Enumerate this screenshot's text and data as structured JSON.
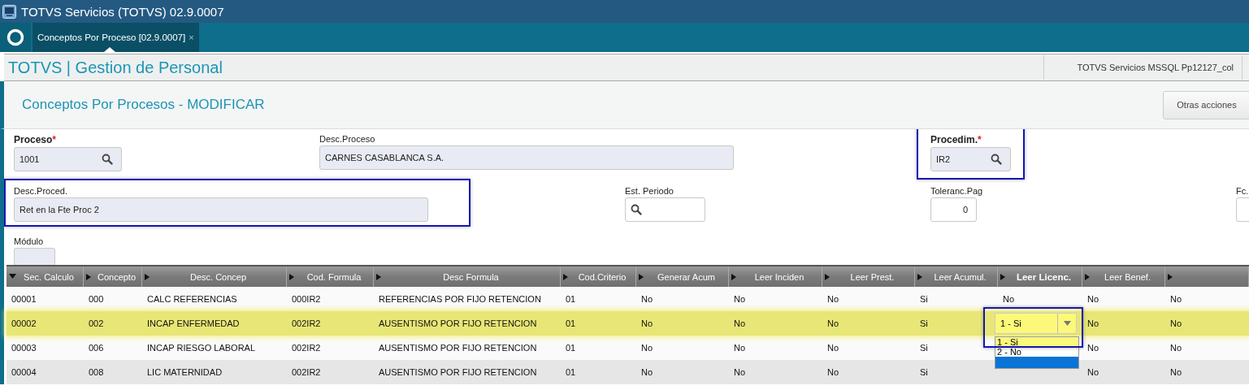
{
  "window": {
    "title": "TOTVS Servicios (TOTVS) 02.9.0007"
  },
  "tabs": [
    {
      "label": "Conceptos Por Proceso [02.9.0007]",
      "close": "×",
      "selected": true
    }
  ],
  "header": {
    "title": "TOTVS | Gestion de Personal",
    "environment": "TOTVS Servicios MSSQL Pp12127_col"
  },
  "page": {
    "title": "Conceptos Por Procesos - MODIFICAR",
    "actions": [
      "Otras acciones"
    ]
  },
  "form": {
    "fields": [
      {
        "kind": "lookup",
        "label": "Proceso",
        "required_mark": "*",
        "value": "1001",
        "editable": false
      },
      {
        "kind": "text",
        "label": "Desc.Proceso",
        "value": "CARNES CASABLANCA S.A.",
        "editable": false
      },
      {
        "kind": "lookup",
        "label": "Procedim.",
        "required_mark": "*",
        "value": "IR2",
        "editable": false,
        "highlighted": true
      },
      {
        "kind": "text",
        "label": "Desc.Proced.",
        "value": "Ret en la Fte Proc 2",
        "editable": false,
        "highlighted": true
      },
      {
        "kind": "lookup",
        "label": "Est. Periodo",
        "editable": true
      },
      {
        "kind": "number",
        "label": "Toleranc.Pag",
        "value": "0",
        "editable": true
      },
      {
        "kind": "text",
        "label": "Fc.",
        "editable": true
      },
      {
        "kind": "text",
        "label": "Módulo",
        "editable": false
      }
    ]
  },
  "table": {
    "columns": [
      {
        "label": "Sec. Calculo",
        "sorted": true,
        "active": false
      },
      {
        "label": "Concepto",
        "sorted": false,
        "active": false
      },
      {
        "label": "Desc. Concep",
        "sorted": false,
        "active": false
      },
      {
        "label": "Cod. Formula",
        "sorted": false,
        "active": false
      },
      {
        "label": "Desc Formula",
        "sorted": false,
        "active": false
      },
      {
        "label": "Cod.Criterio",
        "sorted": false,
        "active": false
      },
      {
        "label": "Generar Acum",
        "sorted": false,
        "active": false
      },
      {
        "label": "Leer Inciden",
        "sorted": false,
        "active": false
      },
      {
        "label": "Leer Prest.",
        "sorted": false,
        "active": false
      },
      {
        "label": "Leer Acumul.",
        "sorted": false,
        "active": false
      },
      {
        "label": "Leer Licenc.",
        "sorted": false,
        "active": true
      },
      {
        "label": "Leer Benef.",
        "sorted": false,
        "active": false
      },
      {
        "sorted": false
      }
    ],
    "rows": [
      {
        "selected": false,
        "cells": [
          "00001",
          "000",
          "CALC REFERENCIAS",
          "000IR2",
          "REFERENCIAS POR FIJO RETENCION",
          "01",
          "No",
          "No",
          "No",
          "Si",
          "No",
          "No",
          "No"
        ]
      },
      {
        "selected": true,
        "cells": [
          "00002",
          "002",
          "INCAP ENFERMEDAD",
          "002IR2",
          "AUSENTISMO POR FIJO RETENCION",
          "01",
          "No",
          "No",
          "No",
          "Si",
          {
            "kind": "dropdown",
            "value": "1 - Si",
            "highlighted": true,
            "options": [
              {
                "label": "1 - Si",
                "selected": true,
                "hovered": false
              },
              {
                "label": "2 - No",
                "selected": false,
                "hovered": false
              },
              {
                "selected": false,
                "hovered": true
              }
            ]
          },
          "No",
          "No"
        ]
      },
      {
        "selected": false,
        "cells": [
          "00003",
          "006",
          "INCAP RIESGO LABORAL",
          "002IR2",
          "AUSENTISMO POR FIJO RETENCION",
          "01",
          "No",
          "No",
          "No",
          "Si",
          null,
          "No",
          "No"
        ]
      },
      {
        "selected": false,
        "cells": [
          "00004",
          "008",
          "LIC MATERNIDAD",
          "002IR2",
          "AUSENTISMO POR FIJO RETENCION",
          "01",
          "No",
          "No",
          "No",
          "Si",
          null,
          "No",
          "No"
        ]
      }
    ]
  }
}
